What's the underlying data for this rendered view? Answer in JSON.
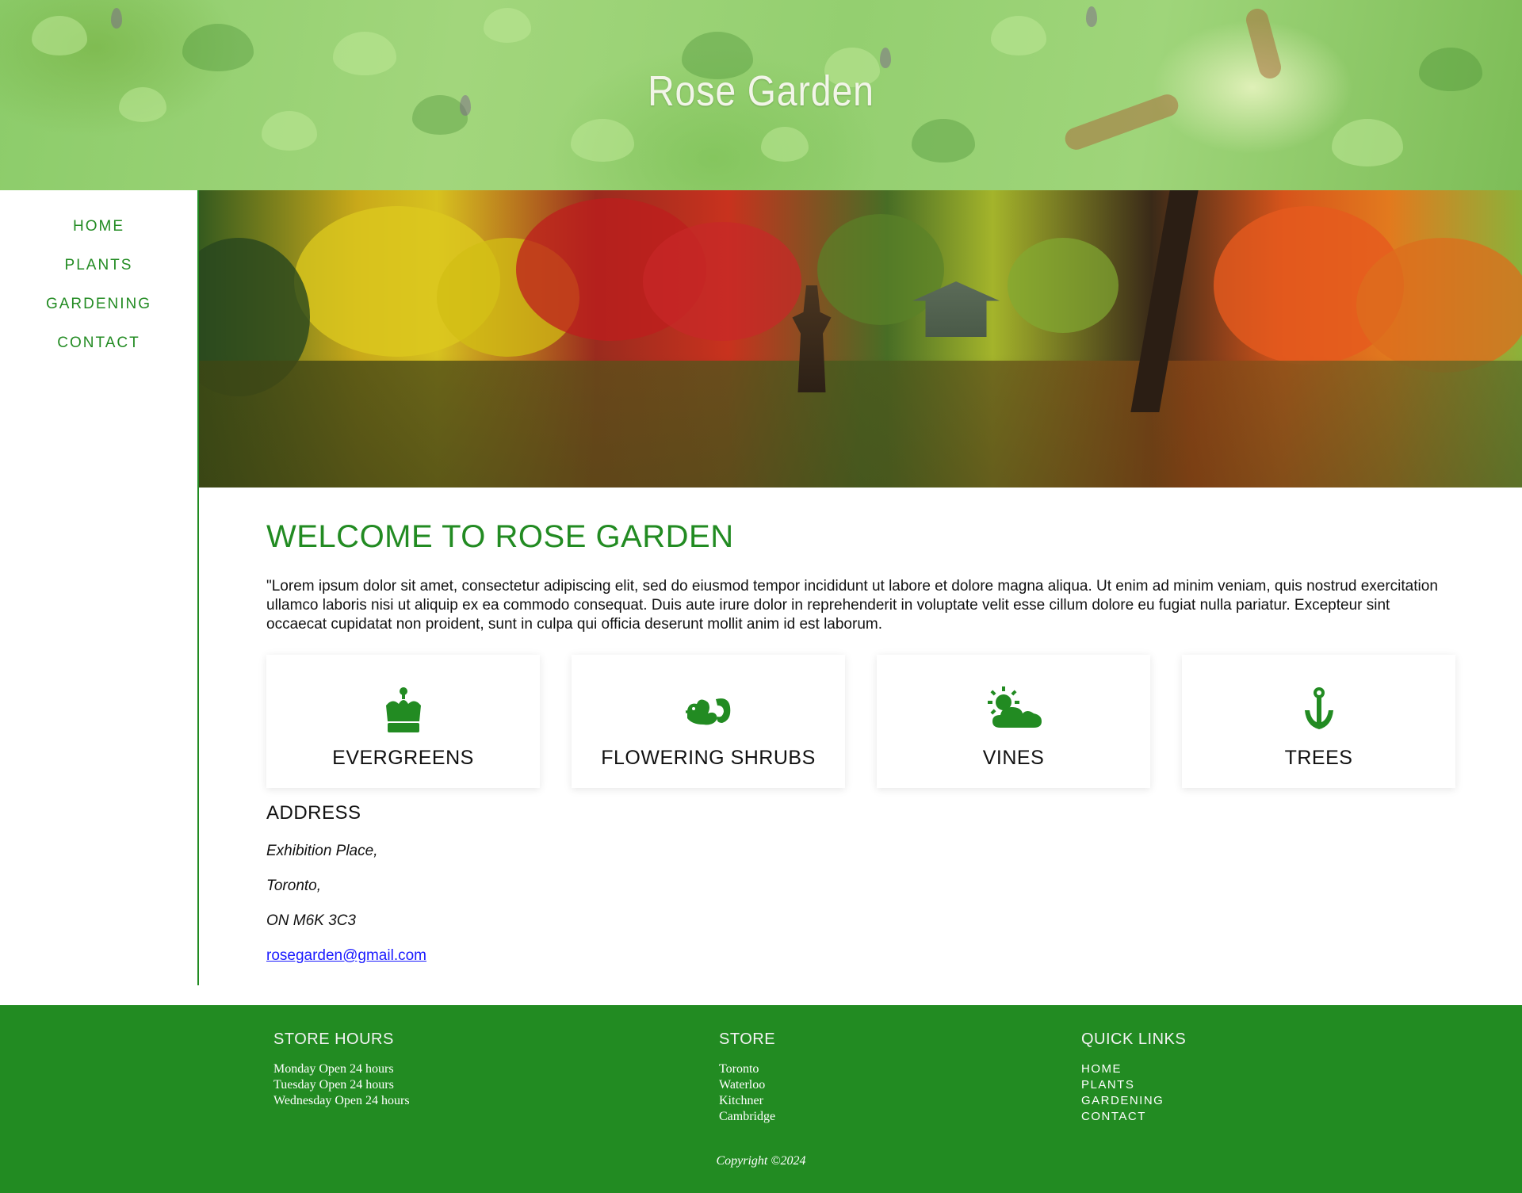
{
  "header": {
    "title": "Rose Garden"
  },
  "nav": {
    "items": [
      {
        "label": "HOME"
      },
      {
        "label": "PLANTS"
      },
      {
        "label": "GARDENING"
      },
      {
        "label": "CONTACT"
      }
    ]
  },
  "main": {
    "heading": "WELCOME TO ROSE GARDEN",
    "intro": "\"Lorem ipsum dolor sit amet, consectetur adipiscing elit, sed do eiusmod tempor incididunt ut labore et dolore magna aliqua. Ut enim ad minim veniam, quis nostrud exercitation ullamco laboris nisi ut aliquip ex ea commodo consequat. Duis aute irure dolor in reprehenderit in voluptate velit esse cillum dolore eu fugiat nulla pariatur. Excepteur sint occaecat cupidatat non proident, sunt in culpa qui officia deserunt mollit anim id est laborum.",
    "categories": [
      {
        "label": "EVERGREENS",
        "icon": "crown-icon"
      },
      {
        "label": "FLOWERING SHRUBS",
        "icon": "dragon-icon"
      },
      {
        "label": "VINES",
        "icon": "cloud-sun-icon"
      },
      {
        "label": "TREES",
        "icon": "anchor-icon"
      }
    ]
  },
  "address": {
    "heading": "ADDRESS",
    "line1": "Exhibition Place,",
    "line2": "Toronto,",
    "line3": "ON M6K 3C3",
    "email": "rosegarden@gmail.com"
  },
  "footer": {
    "hours": {
      "heading": "STORE HOURS",
      "rows": [
        "Monday Open 24 hours",
        "Tuesday Open 24 hours",
        "Wednesday Open 24 hours"
      ]
    },
    "store": {
      "heading": "STORE",
      "rows": [
        "Toronto",
        "Waterloo",
        "Kitchner",
        "Cambridge"
      ]
    },
    "quick_links": {
      "heading": "QUICK LINKS",
      "items": [
        "HOME",
        "PLANTS",
        "GARDENING",
        "CONTACT"
      ]
    },
    "copyright": "Copyright ©2024"
  },
  "colors": {
    "brand_green": "#228b22",
    "link_blue": "#1a1aff"
  }
}
